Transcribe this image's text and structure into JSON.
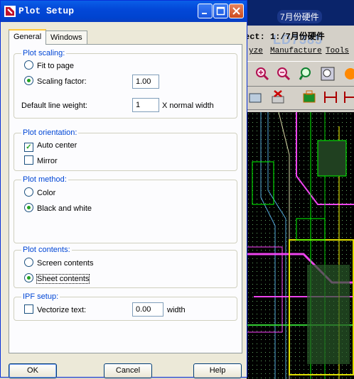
{
  "background_app": {
    "title_fragment": "ect: 1:/7月份硬件",
    "watermark": "7月份硬件",
    "watermark2": "LD7385",
    "menu": [
      "yze",
      "Manufacture",
      "Tools"
    ]
  },
  "dialog": {
    "title": "Plot Setup",
    "tabs": [
      "General",
      "Windows"
    ],
    "plot_scaling": {
      "label": "Plot scaling:",
      "fit_to_page": "Fit to page",
      "scaling_factor": "Scaling factor:",
      "scaling_factor_value": "1.00",
      "default_line_weight": "Default line weight:",
      "line_weight_value": "1",
      "line_weight_unit": "X normal width",
      "selected": "scaling_factor"
    },
    "plot_orientation": {
      "label": "Plot orientation:",
      "auto_center": "Auto center",
      "auto_center_checked": true,
      "mirror": "Mirror",
      "mirror_checked": false
    },
    "plot_method": {
      "label": "Plot method:",
      "color": "Color",
      "black_and_white": "Black and white",
      "selected": "black_and_white"
    },
    "plot_contents": {
      "label": "Plot contents:",
      "screen_contents": "Screen contents",
      "sheet_contents": "Sheet contents",
      "selected": "sheet_contents"
    },
    "ipf_setup": {
      "label": "IPF setup:",
      "vectorize_text": "Vectorize text:",
      "vectorize_checked": false,
      "width_value": "0.00",
      "width_unit": "width"
    },
    "buttons": {
      "ok": "OK",
      "cancel": "Cancel",
      "help": "Help"
    }
  }
}
